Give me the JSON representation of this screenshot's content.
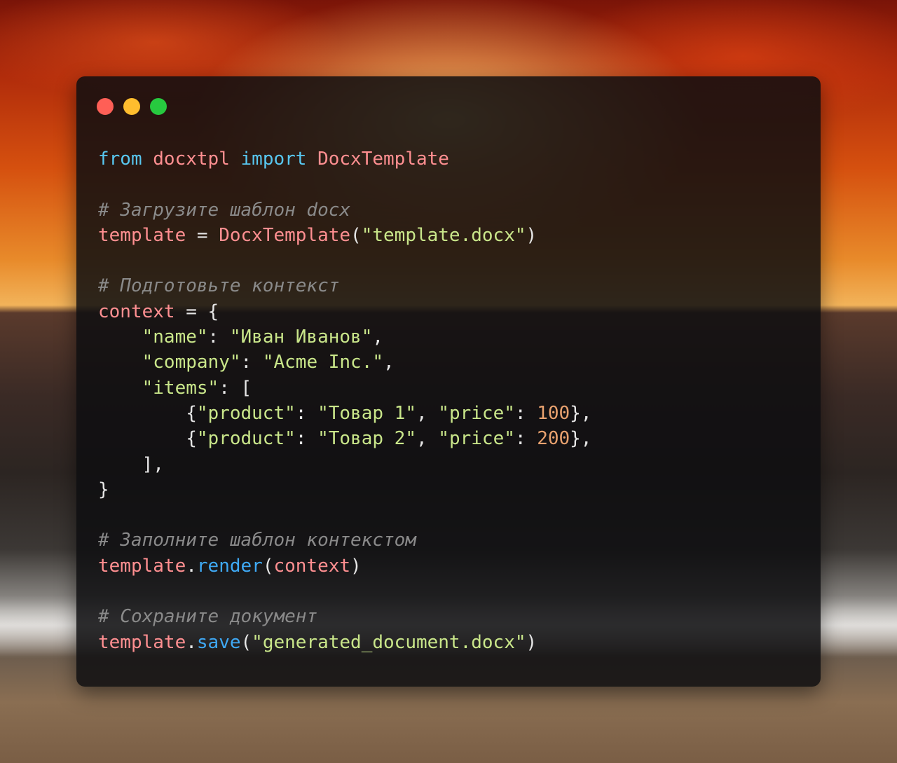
{
  "window": {
    "dots": [
      {
        "name": "close-dot",
        "color": "#ff5f56"
      },
      {
        "name": "minimize-dot",
        "color": "#ffbd2e"
      },
      {
        "name": "maximize-dot",
        "color": "#27c93f"
      }
    ]
  },
  "colors": {
    "keyword": "#58c7f0",
    "identifier": "#ff8f91",
    "function": "#ff8f91",
    "string": "#c9e68a",
    "number": "#e9a26f",
    "comment": "#8a8a8a",
    "method": "#3fa9f5",
    "punct": "#e6e6e6"
  },
  "code": {
    "lines": [
      [
        {
          "t": "kw",
          "v": "from"
        },
        {
          "t": "p",
          "v": " "
        },
        {
          "t": "id",
          "v": "docxtpl"
        },
        {
          "t": "p",
          "v": " "
        },
        {
          "t": "kw",
          "v": "import"
        },
        {
          "t": "p",
          "v": " "
        },
        {
          "t": "id",
          "v": "DocxTemplate"
        }
      ],
      [],
      [
        {
          "t": "cm",
          "v": "# Загрузите шаблон docx"
        }
      ],
      [
        {
          "t": "id",
          "v": "template"
        },
        {
          "t": "p",
          "v": " = "
        },
        {
          "t": "id",
          "v": "DocxTemplate"
        },
        {
          "t": "p",
          "v": "("
        },
        {
          "t": "str",
          "v": "\"template.docx\""
        },
        {
          "t": "p",
          "v": ")"
        }
      ],
      [],
      [
        {
          "t": "cm",
          "v": "# Подготовьте контекст"
        }
      ],
      [
        {
          "t": "id",
          "v": "context"
        },
        {
          "t": "p",
          "v": " = {"
        }
      ],
      [
        {
          "t": "p",
          "v": "    "
        },
        {
          "t": "str",
          "v": "\"name\""
        },
        {
          "t": "p",
          "v": ": "
        },
        {
          "t": "str",
          "v": "\"Иван Иванов\""
        },
        {
          "t": "p",
          "v": ","
        }
      ],
      [
        {
          "t": "p",
          "v": "    "
        },
        {
          "t": "str",
          "v": "\"company\""
        },
        {
          "t": "p",
          "v": ": "
        },
        {
          "t": "str",
          "v": "\"Acme Inc.\""
        },
        {
          "t": "p",
          "v": ","
        }
      ],
      [
        {
          "t": "p",
          "v": "    "
        },
        {
          "t": "str",
          "v": "\"items\""
        },
        {
          "t": "p",
          "v": ": ["
        }
      ],
      [
        {
          "t": "p",
          "v": "        {"
        },
        {
          "t": "str",
          "v": "\"product\""
        },
        {
          "t": "p",
          "v": ": "
        },
        {
          "t": "str",
          "v": "\"Товар 1\""
        },
        {
          "t": "p",
          "v": ", "
        },
        {
          "t": "str",
          "v": "\"price\""
        },
        {
          "t": "p",
          "v": ": "
        },
        {
          "t": "num",
          "v": "100"
        },
        {
          "t": "p",
          "v": "},"
        }
      ],
      [
        {
          "t": "p",
          "v": "        {"
        },
        {
          "t": "str",
          "v": "\"product\""
        },
        {
          "t": "p",
          "v": ": "
        },
        {
          "t": "str",
          "v": "\"Товар 2\""
        },
        {
          "t": "p",
          "v": ", "
        },
        {
          "t": "str",
          "v": "\"price\""
        },
        {
          "t": "p",
          "v": ": "
        },
        {
          "t": "num",
          "v": "200"
        },
        {
          "t": "p",
          "v": "},"
        }
      ],
      [
        {
          "t": "p",
          "v": "    ],"
        }
      ],
      [
        {
          "t": "p",
          "v": "}"
        }
      ],
      [],
      [
        {
          "t": "cm",
          "v": "# Заполните шаблон контекстом"
        }
      ],
      [
        {
          "t": "id",
          "v": "template"
        },
        {
          "t": "p",
          "v": "."
        },
        {
          "t": "fn",
          "v": "render"
        },
        {
          "t": "p",
          "v": "("
        },
        {
          "t": "id",
          "v": "context"
        },
        {
          "t": "p",
          "v": ")"
        }
      ],
      [],
      [
        {
          "t": "cm",
          "v": "# Сохраните документ"
        }
      ],
      [
        {
          "t": "id",
          "v": "template"
        },
        {
          "t": "p",
          "v": "."
        },
        {
          "t": "fn",
          "v": "save"
        },
        {
          "t": "p",
          "v": "("
        },
        {
          "t": "str",
          "v": "\"generated_document.docx\""
        },
        {
          "t": "p",
          "v": ")"
        }
      ]
    ]
  }
}
